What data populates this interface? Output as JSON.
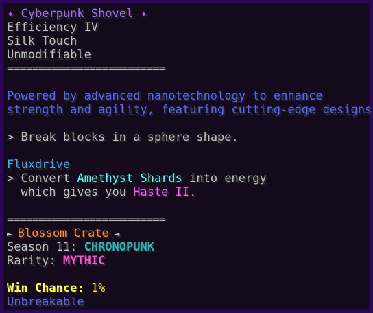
{
  "item": {
    "name_prefix": "✦ ",
    "name": "Cyberpunk Shovel",
    "name_suffix": " ✦",
    "enchantments": [
      "Efficiency IV",
      "Silk Touch"
    ],
    "modifiable": "Unmodifiable"
  },
  "separator": "=========================",
  "description": {
    "line1": "Powered by advanced nanotechnology to enhance",
    "line2": "strength and agility, featuring cutting-edge designs."
  },
  "ability": {
    "bullet": "> ",
    "text": "Break blocks in a sphere shape."
  },
  "fluxdrive": {
    "title": "Fluxdrive",
    "bullet": "> ",
    "convert_prefix": "Convert ",
    "resource": "Amethyst Shards",
    "convert_suffix": " into energy",
    "gives_prefix": "  which gives you ",
    "effect": "Haste II",
    "gives_suffix": "."
  },
  "crate": {
    "left_arrow": "► ",
    "name": "Blossom Crate",
    "right_arrow": " ◄",
    "season_label": "Season 11: ",
    "season_name": "CHRONOPUNK",
    "rarity_label": "Rarity: ",
    "rarity": "MYTHIC",
    "win_label": "Win Chance: ",
    "win_value": "1%"
  },
  "durability": "Unbreakable",
  "colors": {
    "background": "#150a1c",
    "border": "#28075c",
    "title": "#a070ff",
    "description": "#5566ff",
    "aqua": "#55ffff",
    "pink": "#ff55ff",
    "mythic": "#ff4fd8",
    "season": "#2fb4b4",
    "crate": "#ff8c3a",
    "win_label": "#ffff55"
  }
}
